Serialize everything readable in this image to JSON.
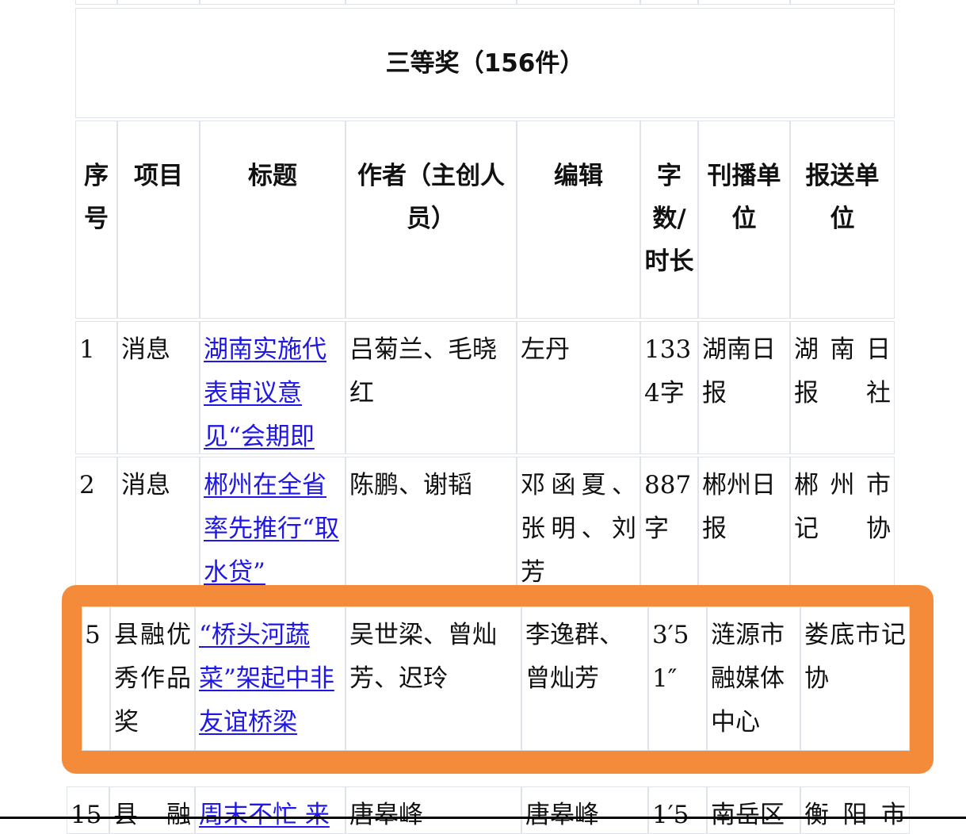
{
  "section_title": "三等奖（156件）",
  "headers": {
    "seq": "序号",
    "category": "项目",
    "title": "标题",
    "author": "作者（主创人员）",
    "editor": "编辑",
    "length": "字数/时长",
    "publisher": "刊播单位",
    "submitter": "报送单位"
  },
  "rows": [
    {
      "seq": "1",
      "category": "消息",
      "title": "湖南实施代表审议意见“会期即复”",
      "author": "吕菊兰、毛晓红",
      "editor": "左丹",
      "length": "1334字",
      "publisher": "湖南日报",
      "submitter": "湖南日报社"
    },
    {
      "seq": "2",
      "category": "消息",
      "title": "郴州在全省率先推行“取水贷”",
      "author": "陈鹏、谢韬",
      "editor": "邓函夏、张明、刘芳",
      "length": "887字",
      "publisher": "郴州日报",
      "submitter": "郴州市记协"
    },
    {
      "seq": "5",
      "category": "县融优秀作品奖",
      "title": "“桥头河蔬菜”架起中非友谊桥梁",
      "author": "吴世梁、曾灿芳、迟玲",
      "editor": "李逸群、曾灿芳",
      "length": "3′51″",
      "publisher": "涟源市融媒体中心",
      "submitter": "娄底市记协"
    },
    {
      "seq": "15",
      "category": "县融",
      "title": "周末不忙 来",
      "author": "唐皋峰",
      "editor": "唐皋峰",
      "length": "1′5",
      "publisher": "南岳区",
      "submitter": "衡阳市"
    }
  ]
}
